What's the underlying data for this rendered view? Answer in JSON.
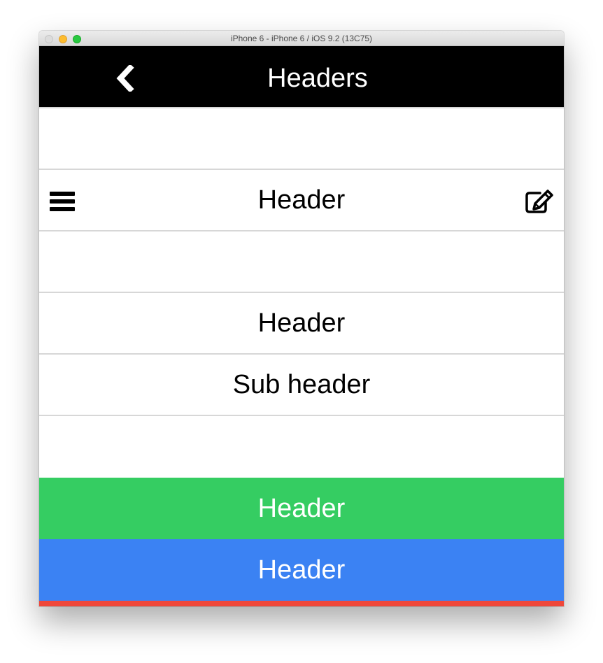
{
  "window": {
    "title": "iPhone 6 - iPhone 6 / iOS 9.2 (13C75)"
  },
  "navbar": {
    "title": "Headers",
    "back_icon": "chevron-left-icon"
  },
  "rows": {
    "header_with_icons": {
      "title": "Header",
      "left_icon": "menu-icon",
      "right_icon": "edit-icon"
    },
    "plain_header": {
      "title": "Header"
    },
    "sub_header": {
      "title": "Sub header"
    },
    "green_header": {
      "title": "Header",
      "color": "#35cd62"
    },
    "blue_header": {
      "title": "Header",
      "color": "#3b82f3"
    },
    "red_strip": {
      "color": "#ef473a"
    }
  },
  "colors": {
    "navbar_background": "#000000",
    "divider": "#d7d7d7",
    "traffic_close": "#dcdcdc",
    "traffic_minimize": "#fdbc2e",
    "traffic_zoom": "#28c840"
  }
}
